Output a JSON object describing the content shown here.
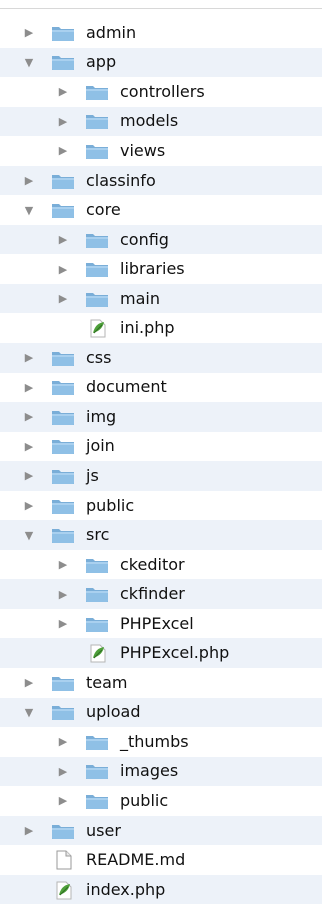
{
  "tree": [
    {
      "label": "admin",
      "type": "folder",
      "depth": 0,
      "expanded": false
    },
    {
      "label": "app",
      "type": "folder",
      "depth": 0,
      "expanded": true
    },
    {
      "label": "controllers",
      "type": "folder",
      "depth": 1,
      "expanded": false
    },
    {
      "label": "models",
      "type": "folder",
      "depth": 1,
      "expanded": false
    },
    {
      "label": "views",
      "type": "folder",
      "depth": 1,
      "expanded": false
    },
    {
      "label": "classinfo",
      "type": "folder",
      "depth": 0,
      "expanded": false
    },
    {
      "label": "core",
      "type": "folder",
      "depth": 0,
      "expanded": true
    },
    {
      "label": "config",
      "type": "folder",
      "depth": 1,
      "expanded": false
    },
    {
      "label": "libraries",
      "type": "folder",
      "depth": 1,
      "expanded": false
    },
    {
      "label": "main",
      "type": "folder",
      "depth": 1,
      "expanded": false
    },
    {
      "label": "ini.php",
      "type": "php",
      "depth": 1
    },
    {
      "label": "css",
      "type": "folder",
      "depth": 0,
      "expanded": false
    },
    {
      "label": "document",
      "type": "folder",
      "depth": 0,
      "expanded": false
    },
    {
      "label": "img",
      "type": "folder",
      "depth": 0,
      "expanded": false
    },
    {
      "label": "join",
      "type": "folder",
      "depth": 0,
      "expanded": false
    },
    {
      "label": "js",
      "type": "folder",
      "depth": 0,
      "expanded": false
    },
    {
      "label": "public",
      "type": "folder",
      "depth": 0,
      "expanded": false
    },
    {
      "label": "src",
      "type": "folder",
      "depth": 0,
      "expanded": true
    },
    {
      "label": "ckeditor",
      "type": "folder",
      "depth": 1,
      "expanded": false
    },
    {
      "label": "ckfinder",
      "type": "folder",
      "depth": 1,
      "expanded": false
    },
    {
      "label": "PHPExcel",
      "type": "folder",
      "depth": 1,
      "expanded": false
    },
    {
      "label": "PHPExcel.php",
      "type": "php",
      "depth": 1
    },
    {
      "label": "team",
      "type": "folder",
      "depth": 0,
      "expanded": false
    },
    {
      "label": "upload",
      "type": "folder",
      "depth": 0,
      "expanded": true
    },
    {
      "label": "_thumbs",
      "type": "folder",
      "depth": 1,
      "expanded": false
    },
    {
      "label": "images",
      "type": "folder",
      "depth": 1,
      "expanded": false
    },
    {
      "label": "public",
      "type": "folder",
      "depth": 1,
      "expanded": false
    },
    {
      "label": "user",
      "type": "folder",
      "depth": 0,
      "expanded": false
    },
    {
      "label": "README.md",
      "type": "file",
      "depth": 0
    },
    {
      "label": "index.php",
      "type": "php",
      "depth": 0
    }
  ],
  "colors": {
    "row_alt": "#edf2f9",
    "folder": "#8fc0e6",
    "folder_tab": "#7aaed8",
    "php_icon": "#4ea03a",
    "arrow": "#8d8d8d"
  }
}
